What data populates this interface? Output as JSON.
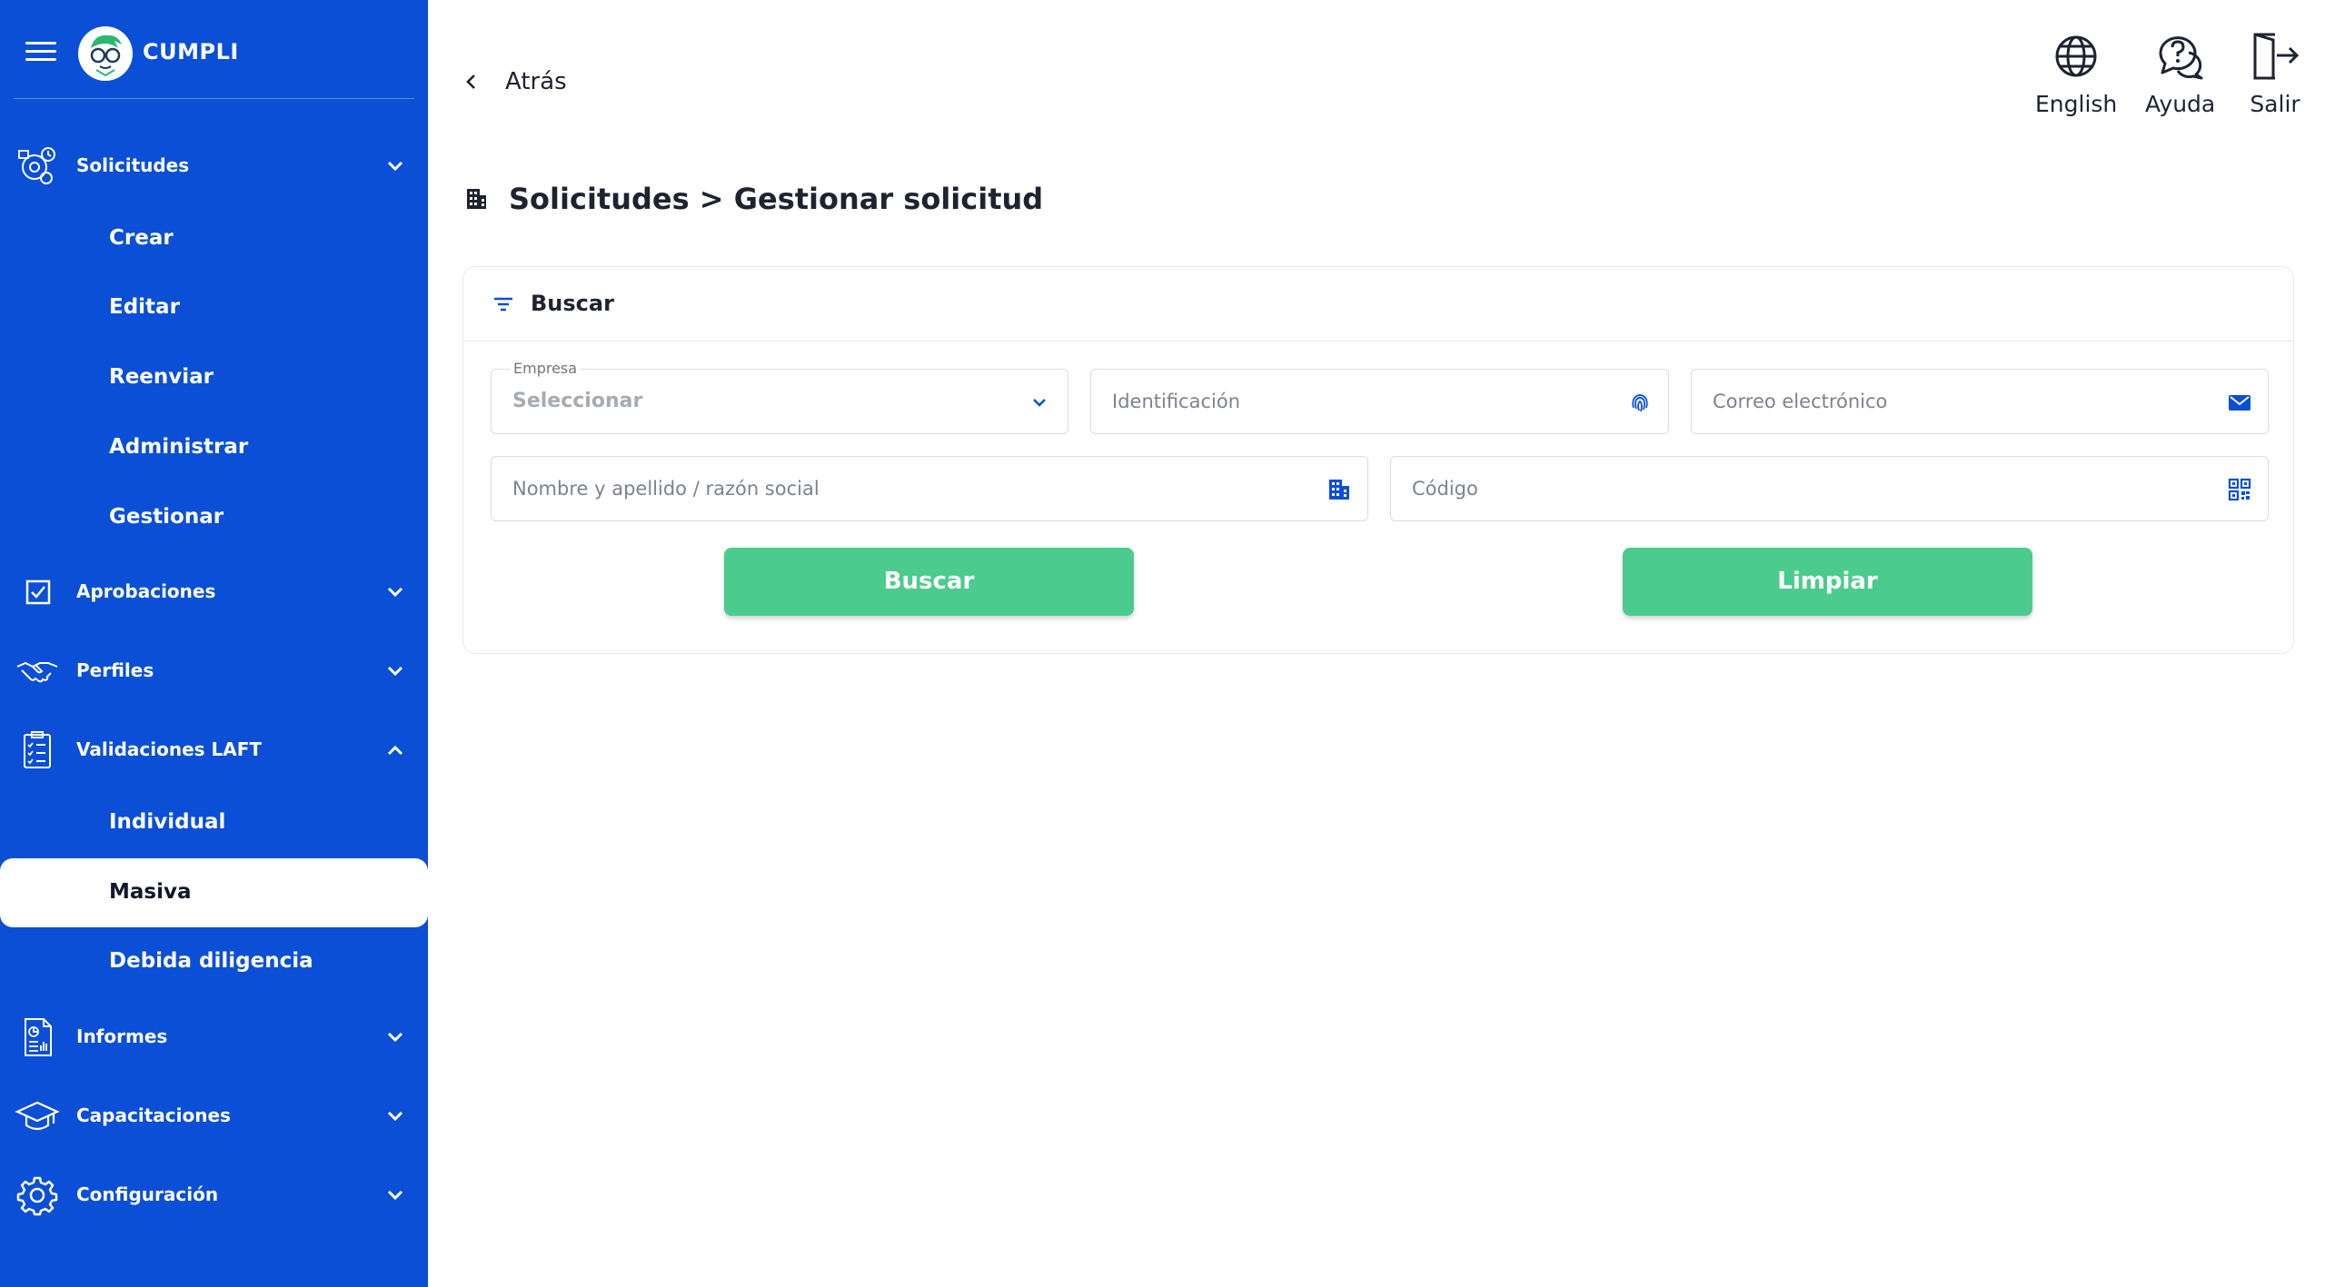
{
  "app": {
    "brand": "CUMPLI"
  },
  "colors": {
    "sidebar": "#0a4fd6",
    "accent_button": "#4ccb8f",
    "icon_blue": "#0a4fd6",
    "active_item_bg": "#ffffff"
  },
  "sidebar": {
    "sections": [
      {
        "label": "Solicitudes",
        "icon": "requests-gear-icon",
        "expanded": true,
        "items": [
          "Crear",
          "Editar",
          "Reenviar",
          "Administrar",
          "Gestionar"
        ]
      },
      {
        "label": "Aprobaciones",
        "icon": "checkbox-icon",
        "expanded": false
      },
      {
        "label": "Perfiles",
        "icon": "handshake-icon",
        "expanded": false
      },
      {
        "label": "Validaciones LAFT",
        "icon": "clipboard-checklist-icon",
        "expanded": true,
        "items": [
          "Individual",
          "Masiva",
          "Debida diligencia"
        ],
        "active_item": "Masiva"
      },
      {
        "label": "Informes",
        "icon": "report-chart-icon",
        "expanded": false
      },
      {
        "label": "Capacitaciones",
        "icon": "graduation-cap-icon",
        "expanded": false
      },
      {
        "label": "Configuración",
        "icon": "gear-icon",
        "expanded": false
      }
    ]
  },
  "header": {
    "back_label": "Atrás",
    "actions": [
      {
        "label": "English",
        "icon": "globe-icon"
      },
      {
        "label": "Ayuda",
        "icon": "help-chat-icon"
      },
      {
        "label": "Salir",
        "icon": "logout-icon"
      }
    ]
  },
  "page": {
    "title": "Solicitudes > Gestionar solicitud"
  },
  "search": {
    "title": "Buscar",
    "empresa": {
      "label": "Empresa",
      "value": "Seleccionar"
    },
    "identificacion": {
      "placeholder": "Identificación"
    },
    "correo": {
      "placeholder": "Correo electrónico"
    },
    "nombre": {
      "placeholder": "Nombre y apellido / razón social"
    },
    "codigo": {
      "placeholder": "Código"
    },
    "search_button": "Buscar",
    "clear_button": "Limpiar"
  }
}
